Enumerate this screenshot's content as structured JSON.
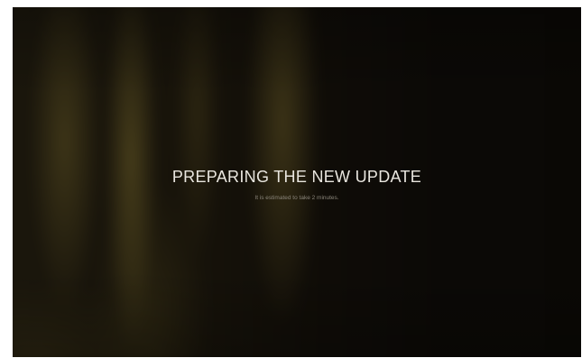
{
  "screen": {
    "title": "PREPARING THE NEW UPDATE",
    "subtitle": "It is estimated to take 2 minutes."
  },
  "colors": {
    "background": "#0b0906",
    "accent_glow": "#6e6028",
    "title_text": "#e9e6df",
    "subtitle_text": "#8a857a"
  }
}
